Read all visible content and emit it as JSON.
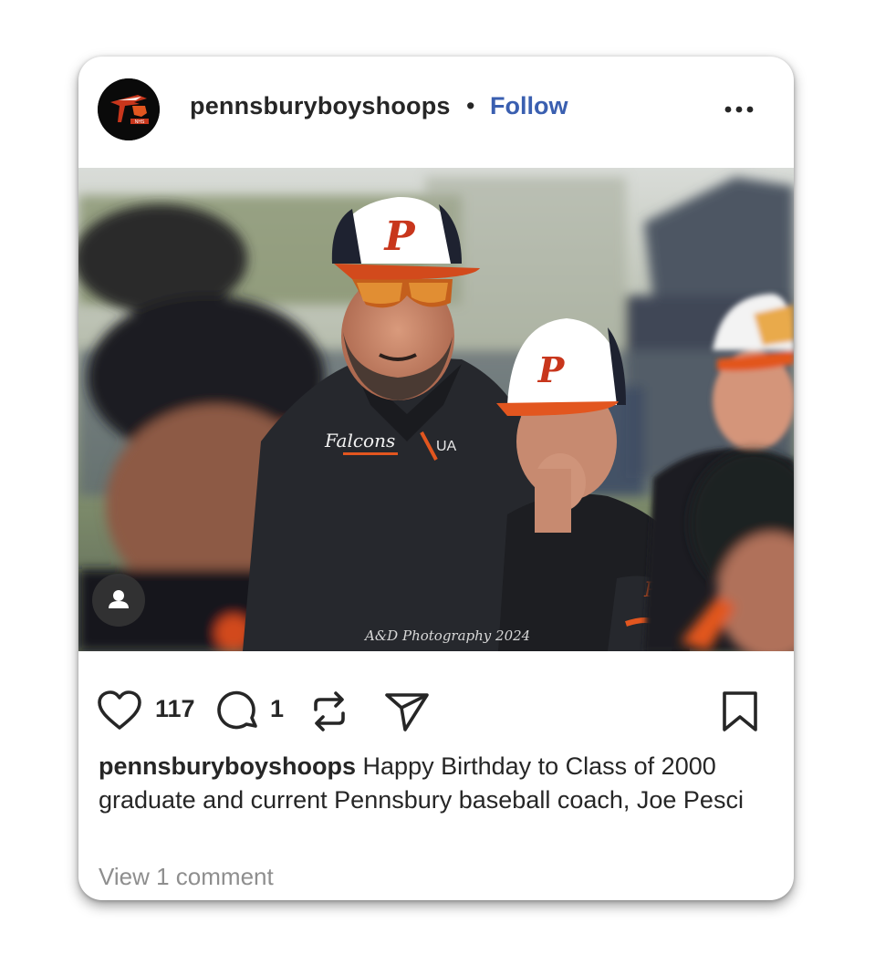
{
  "post": {
    "username": "pennsburyboyshoops",
    "separator": "•",
    "follow_label": "Follow",
    "more_icon": "more-horizontal-icon",
    "avatar_logo": "falcons-logo",
    "photo_credit": "A&D Photography 2024",
    "jacket_text": "Falcons",
    "likes_count": "117",
    "comments_count": "1",
    "caption_username": "pennsburyboyshoops",
    "caption_text": " Happy Birthday to Class of 2000 graduate and current Pennsbury baseball coach, Joe Pesci",
    "view_comments_label": "View 1 comment"
  },
  "colors": {
    "follow_blue": "#3a5fb0",
    "text_dark": "#262626",
    "text_muted": "#8e8e8e",
    "team_orange": "#e2561f"
  }
}
